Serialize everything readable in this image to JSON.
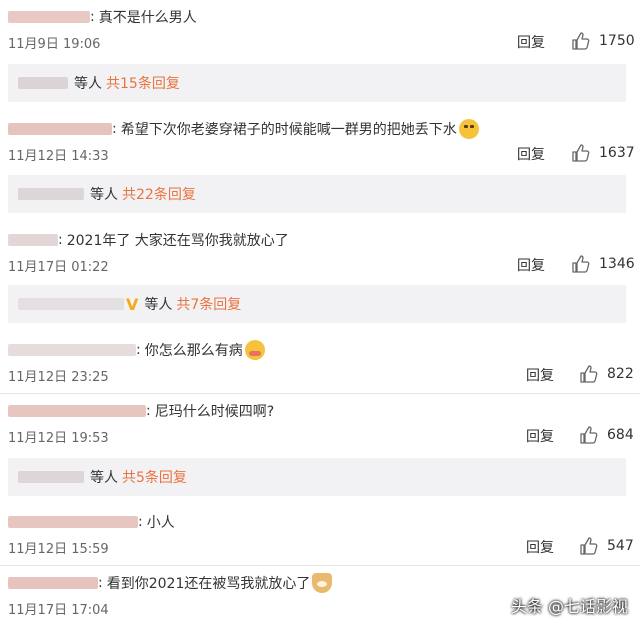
{
  "comments": [
    {
      "text": "真不是什么男人",
      "time": "11月9日 19:06",
      "reply": "回复",
      "likes": "1750"
    },
    {
      "text": "希望下次你老婆穿裙子的时候能喊一群男的把她丢下水",
      "time": "11月12日 14:33",
      "reply": "回复",
      "likes": "1637",
      "emoji": "sad-face-icon"
    },
    {
      "text": "2021年了 大家还在骂你我就放心了",
      "time": "11月17日 01:22",
      "reply": "回复",
      "likes": "1346"
    },
    {
      "text": "你怎么那么有病",
      "time": "11月12日 23:25",
      "reply": "回复",
      "likes": "822",
      "emoji": "sick-face-icon"
    },
    {
      "text": "尼玛什么时候四啊?",
      "time": "11月12日 19:53",
      "reply": "回复",
      "likes": "684"
    },
    {
      "text": "小人",
      "time": "11月12日 15:59",
      "reply": "回复",
      "likes": "547"
    },
    {
      "text": "看到你2021还在被骂我就放心了",
      "time": "11月17日 17:04",
      "reply": "回复",
      "likes": "",
      "emoji": "doge-icon"
    }
  ],
  "subreplies": [
    {
      "who": "等人",
      "link": "共15条回复"
    },
    {
      "who": "等人",
      "link": "共22条回复"
    },
    {
      "who": "等人",
      "link": "共7条回复",
      "badge": "V"
    },
    {
      "who": "等人",
      "link": "共5条回复"
    }
  ],
  "watermark": "头条 @七话影视",
  "colors": {
    "link": "#eb7340",
    "subbox_bg": "#f2f2f5",
    "badge": "#f4a81b"
  }
}
